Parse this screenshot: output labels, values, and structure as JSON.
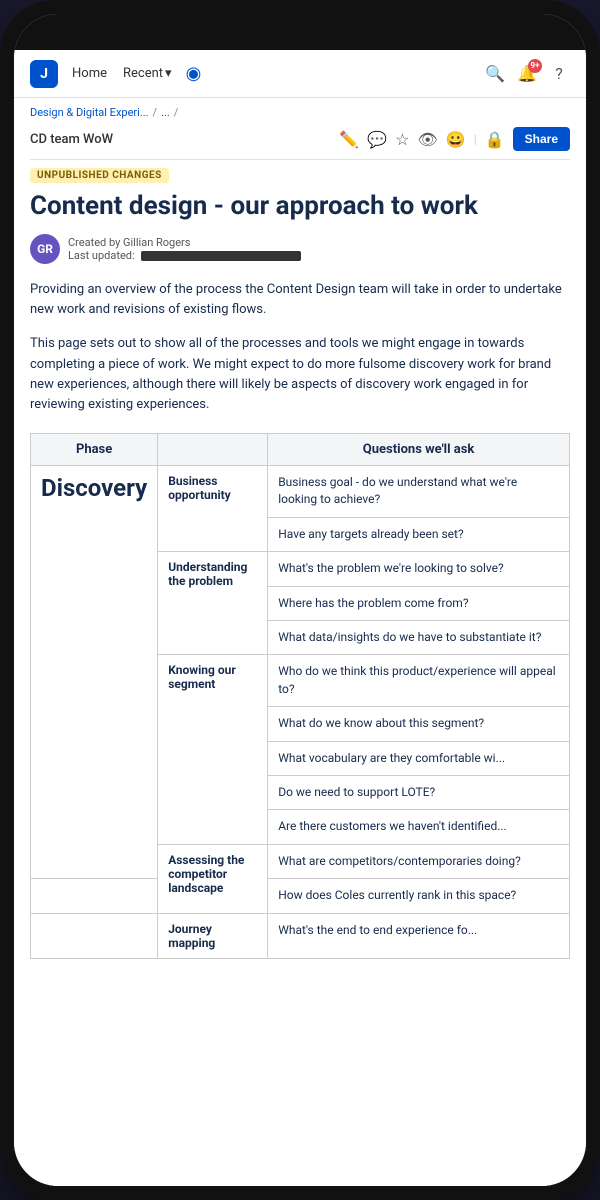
{
  "phone": {
    "nav": {
      "logo": "J",
      "home_label": "Home",
      "recent_label": "Recent",
      "chevron": "▾",
      "search_icon": "🔍",
      "notification_icon": "🔔",
      "notification_badge": "9+",
      "help_icon": "?",
      "share_label": "Share"
    },
    "breadcrumb": {
      "parent": "Design & Digital Experi...",
      "sep1": "/",
      "middle": "...",
      "sep2": "/",
      "current": "CD team WoW"
    },
    "toolbar_icons": [
      "✏️",
      "💬",
      "☆",
      "👁",
      "😀",
      "|",
      "🔒"
    ],
    "badge": {
      "label": "UNPUBLISHED CHANGES"
    },
    "title": "Content design - our approach to work",
    "author": {
      "initials": "GR",
      "created_label": "Created by Gillian Rogers",
      "updated_label": "Last updated:"
    },
    "body": {
      "paragraph1": "Providing an overview of the process the Content Design team will take in order to undertake new work and revisions of existing flows.",
      "paragraph2": "This page sets out to show all of the processes and tools we might engage in towards completing a piece of work. We might expect to do more fulsome discovery work for brand new experiences, although there will likely be aspects of discovery work engaged in for reviewing existing experiences."
    },
    "table": {
      "headers": [
        "Phase",
        "",
        "Questions we'll ask"
      ],
      "rows": [
        {
          "phase": "Discovery",
          "subphase": "Business opportunity",
          "questions": [
            "Business goal - do we understand what we're looking to achieve?",
            "Have any targets already been set?"
          ]
        },
        {
          "phase": "",
          "subphase": "Understanding the problem",
          "questions": [
            "What's the problem we're looking to solve?",
            "Where has the problem come from?",
            "What data/insights do we have to substantiate it?"
          ]
        },
        {
          "phase": "",
          "subphase": "Knowing our segment",
          "questions": [
            "Who do we think this product/experience will appeal to?",
            "What do we know about this segment?",
            "What vocabulary are they comfortable wi...",
            "Do we need to support LOTE?",
            "Are there customers we haven't identified..."
          ]
        },
        {
          "phase": "",
          "subphase": "Assessing the competitor landscape",
          "questions": [
            "What are competitors/contemporaries doing?",
            "How does Coles currently rank in this space?"
          ]
        },
        {
          "phase": "",
          "subphase": "Journey mapping",
          "questions": [
            "What's the end to end experience fo..."
          ]
        }
      ]
    }
  }
}
